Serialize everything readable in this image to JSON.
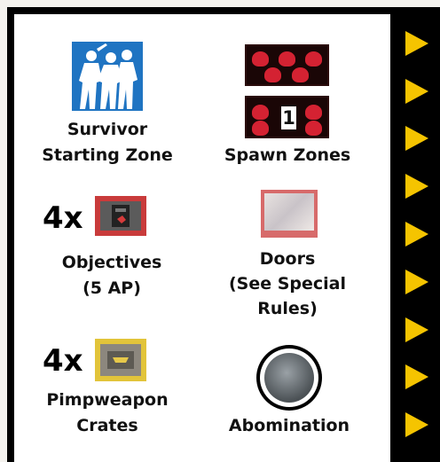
{
  "legend": {
    "survivor": {
      "lines": [
        "Survivor",
        "Starting Zone"
      ],
      "icon": "survivor-tile-icon"
    },
    "spawn": {
      "label": "Spawn Zones",
      "number": "1",
      "icon": "spawn-zone-tile-icon"
    },
    "objectives": {
      "qty": "4x",
      "lines": [
        "Objectives",
        "(5 AP)"
      ],
      "icon": "objective-token-icon"
    },
    "doors": {
      "lines": [
        "Doors",
        "(See Special",
        "Rules)"
      ],
      "icon": "door-token-icon"
    },
    "pimpweapon": {
      "qty": "4x",
      "lines": [
        "Pimpweapon",
        "Crates"
      ],
      "icon": "pimpweapon-crate-icon"
    },
    "abomination": {
      "label": "Abomination",
      "icon": "abomination-token-icon"
    }
  },
  "colors": {
    "arrow": "#f5c400",
    "survivor_tile": "#1f74c2",
    "spawn_red": "#d42232",
    "objective_border": "#c93b3b",
    "crate_border": "#e2c43a"
  }
}
